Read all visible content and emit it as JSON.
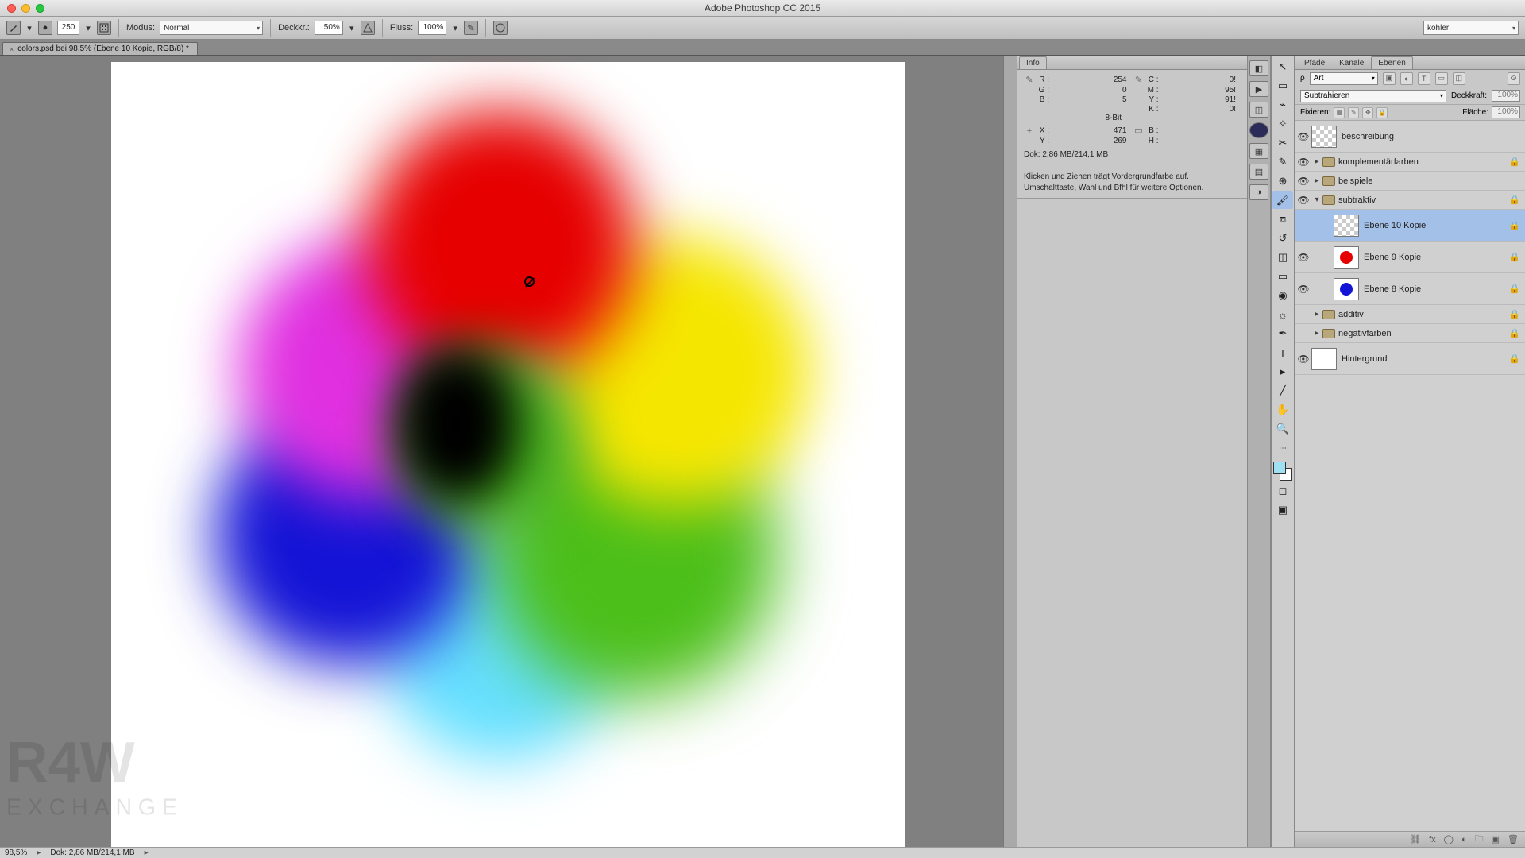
{
  "app_title": "Adobe Photoshop CC 2015",
  "doc_tab": "colors.psd bei 98,5% (Ebene 10 Kopie, RGB/8) *",
  "workspace_name": "kohler",
  "options": {
    "brush_size": "250",
    "modus_label": "Modus:",
    "modus_value": "Normal",
    "opacity_label": "Deckkr.:",
    "opacity_value": "50%",
    "flow_label": "Fluss:",
    "flow_value": "100%"
  },
  "status": {
    "zoom": "98,5%",
    "doc_info": "Dok: 2,86 MB/214,1 MB"
  },
  "info_panel": {
    "tab": "Info",
    "r_lbl": "R :",
    "r_val": "254",
    "g_lbl": "G :",
    "g_val": "0",
    "b_lbl": "B :",
    "b_val": "5",
    "c_lbl": "C :",
    "c_val": "0!",
    "m_lbl": "M :",
    "m_val": "95!",
    "y_lbl": "Y :",
    "y_val": "91!",
    "k_lbl": "K :",
    "k_val": "0!",
    "bit": "8-Bit",
    "x_lbl": "X :",
    "x_val": "471",
    "ycoord_lbl": "Y :",
    "ycoord_val": "269",
    "w_lbl": "B :",
    "w_val": "",
    "h_lbl": "H :",
    "h_val": "",
    "doc": "Dok: 2,86 MB/214,1 MB",
    "hint1": "Klicken und Ziehen trägt Vordergrundfarbe auf.",
    "hint2": "Umschalttaste, Wahl und Bfhl für weitere Optionen."
  },
  "layers_panel": {
    "tabs": {
      "pfade": "Pfade",
      "kanale": "Kanäle",
      "ebenen": "Ebenen"
    },
    "kind_label": "Art",
    "blend_mode": "Subtrahieren",
    "opacity_label": "Deckkraft:",
    "opacity_value": "100%",
    "lock_label": "Fixieren:",
    "fill_label": "Fläche:",
    "fill_value": "100%",
    "items": [
      {
        "type": "layer",
        "name": "beschreibung",
        "vis": true,
        "thumb": "checker",
        "lock": false
      },
      {
        "type": "folder",
        "name": "komplementärfarben",
        "vis": true,
        "open": false,
        "lock": true
      },
      {
        "type": "folder",
        "name": "beispiele",
        "vis": true,
        "open": false,
        "lock": false
      },
      {
        "type": "folder",
        "name": "subtraktiv",
        "vis": true,
        "open": true,
        "lock": true
      },
      {
        "type": "layer",
        "name": "Ebene 10 Kopie",
        "vis": false,
        "thumb": "checker",
        "selected": true,
        "indent": 2,
        "lock": true
      },
      {
        "type": "layer",
        "name": "Ebene 9 Kopie",
        "vis": true,
        "thumb": "red",
        "indent": 2,
        "lock": true
      },
      {
        "type": "layer",
        "name": "Ebene 8 Kopie",
        "vis": true,
        "thumb": "blue",
        "indent": 2,
        "lock": true
      },
      {
        "type": "folder",
        "name": "additiv",
        "vis": false,
        "open": false,
        "lock": true
      },
      {
        "type": "folder",
        "name": "negativfarben",
        "vis": false,
        "open": false,
        "lock": true
      },
      {
        "type": "layer",
        "name": "Hintergrund",
        "vis": true,
        "thumb": "white",
        "lock": true
      }
    ]
  }
}
